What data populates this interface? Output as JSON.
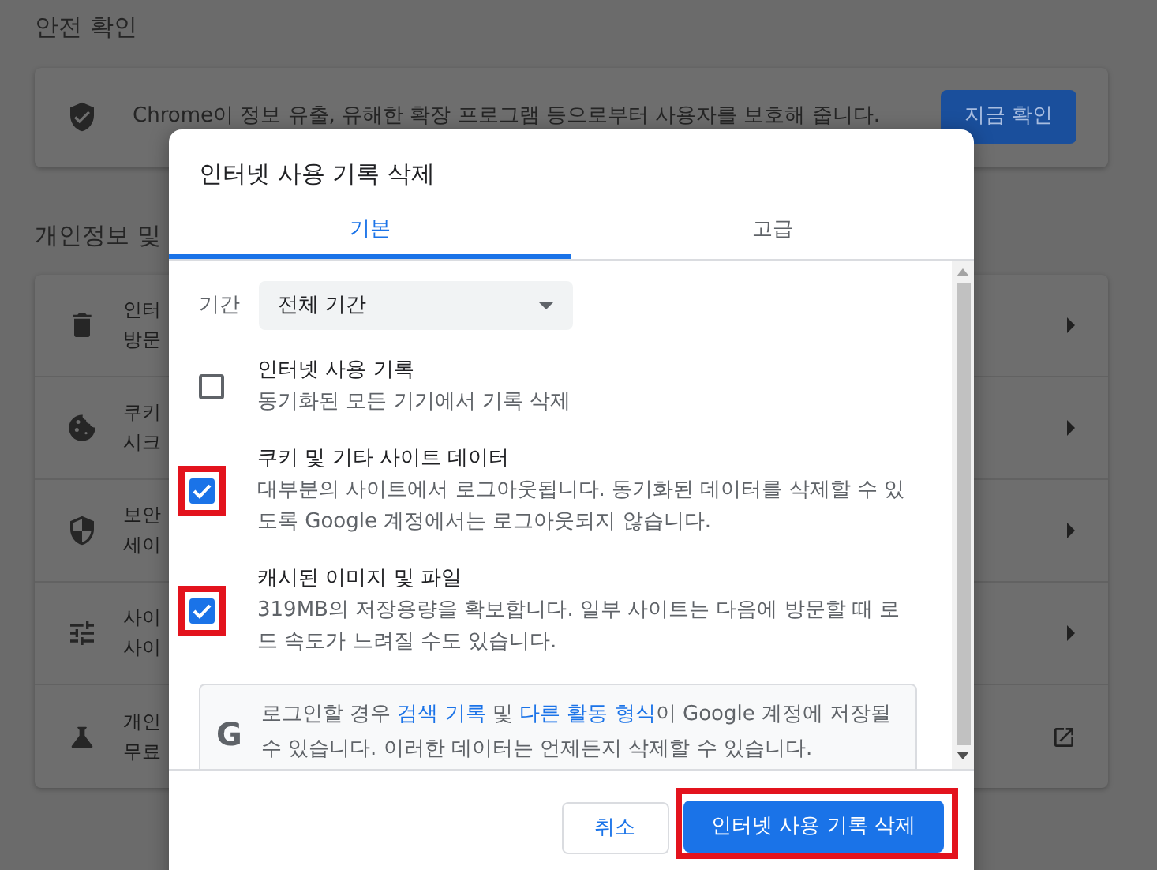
{
  "page": {
    "safety_heading": "안전 확인",
    "safety_card": {
      "text": "Chrome이 정보 유출, 유해한 확장 프로그램 등으로부터 사용자를 보호해 줍니다.",
      "button": "지금 확인"
    },
    "privacy_heading": "개인정보 및",
    "privacy_rows": [
      {
        "title": "인터",
        "subtitle": "방문",
        "external": false
      },
      {
        "title": "쿠키",
        "subtitle": "시크",
        "external": false
      },
      {
        "title": "보안",
        "subtitle": "세이",
        "external": false
      },
      {
        "title": "사이",
        "subtitle": "사이",
        "external": false
      },
      {
        "title": "개인",
        "subtitle": "무료",
        "external": true
      }
    ]
  },
  "dialog": {
    "title": "인터넷 사용 기록 삭제",
    "tabs": [
      {
        "label": "기본",
        "selected": true
      },
      {
        "label": "고급",
        "selected": false
      }
    ],
    "period": {
      "label": "기간",
      "value": "전체 기간"
    },
    "options": [
      {
        "title": "인터넷 사용 기록",
        "description": "동기화된 모든 기기에서 기록 삭제",
        "checked": false,
        "highlighted": false
      },
      {
        "title": "쿠키 및 기타 사이트 데이터",
        "description": "대부분의 사이트에서 로그아웃됩니다. 동기화된 데이터를 삭제할 수 있도록 Google 계정에서는 로그아웃되지 않습니다.",
        "checked": true,
        "highlighted": true
      },
      {
        "title": "캐시된 이미지 및 파일",
        "description": "319MB의 저장용량을 확보합니다. 일부 사이트는 다음에 방문할 때 로드 속도가 느려질 수도 있습니다.",
        "checked": true,
        "highlighted": true
      }
    ],
    "info": {
      "icon_letter": "G",
      "parts": [
        {
          "text": "로그인할 경우 ",
          "link": false
        },
        {
          "text": "검색 기록",
          "link": true
        },
        {
          "text": " 및 ",
          "link": false
        },
        {
          "text": "다른 활동 형식",
          "link": true
        },
        {
          "text": "이 Google 계정에 저장될 수 있습니다. 이러한 데이터는 언제든지 삭제할 수 있습니다.",
          "link": false
        }
      ]
    },
    "buttons": [
      {
        "label": "취소",
        "kind": "secondary",
        "highlighted": false
      },
      {
        "label": "인터넷 사용 기록 삭제",
        "kind": "primary",
        "highlighted": true
      }
    ]
  }
}
